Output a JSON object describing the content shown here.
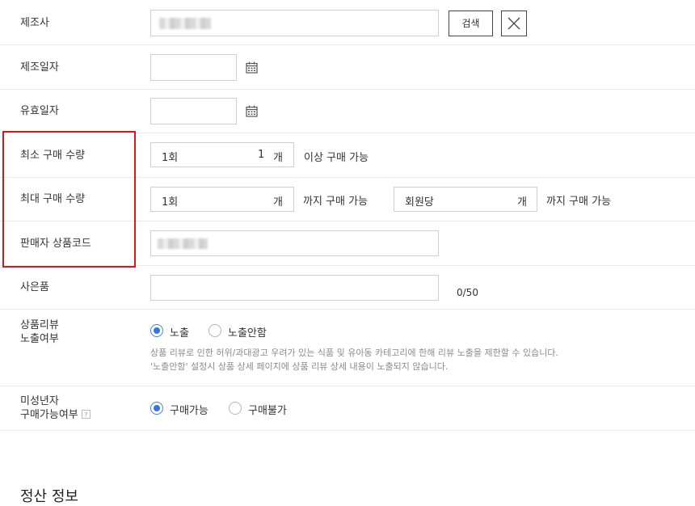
{
  "manufacturer": {
    "label": "제조사",
    "search_button": "검색"
  },
  "manufacture_date": {
    "label": "제조일자"
  },
  "expiry_date": {
    "label": "유효일자"
  },
  "min_purchase": {
    "label": "최소 구매 수량",
    "prefix": "1회",
    "value": "1",
    "unit": "개",
    "suffix": "이상 구매 가능"
  },
  "max_purchase": {
    "label": "최대 구매 수량",
    "per_time_prefix": "1회",
    "per_time_unit": "개",
    "per_time_suffix": "까지 구매 가능",
    "per_member_prefix": "회원당",
    "per_member_unit": "개",
    "per_member_suffix": "까지 구매 가능"
  },
  "seller_code": {
    "label": "판매자 상품코드"
  },
  "gift": {
    "label": "사은품",
    "counter": "0/50"
  },
  "review_exposure": {
    "label_line1": "상품리뷰",
    "label_line2": "노출여부",
    "options": [
      "노출",
      "노출안함"
    ],
    "selected": "노출",
    "help_line1": "상품 리뷰로 인한 허위/과대광고 우려가 있는 식품 및 유아동 카테고리에 한해 리뷰 노출을 제한할 수 있습니다.",
    "help_line2": "'노출안함' 설정시 상품 상세 페이지에 상품 리뷰 상세 내용이 노출되지 않습니다."
  },
  "minor_purchase": {
    "label_line1": "미성년자",
    "label_line2": "구매가능여부",
    "help_mark": "?",
    "options": [
      "구매가능",
      "구매불가"
    ],
    "selected": "구매가능"
  },
  "next_section": {
    "title_partial": "정산 정보"
  },
  "icons": {
    "calendar": "calendar-icon",
    "close": "close-icon",
    "help": "help-icon"
  }
}
